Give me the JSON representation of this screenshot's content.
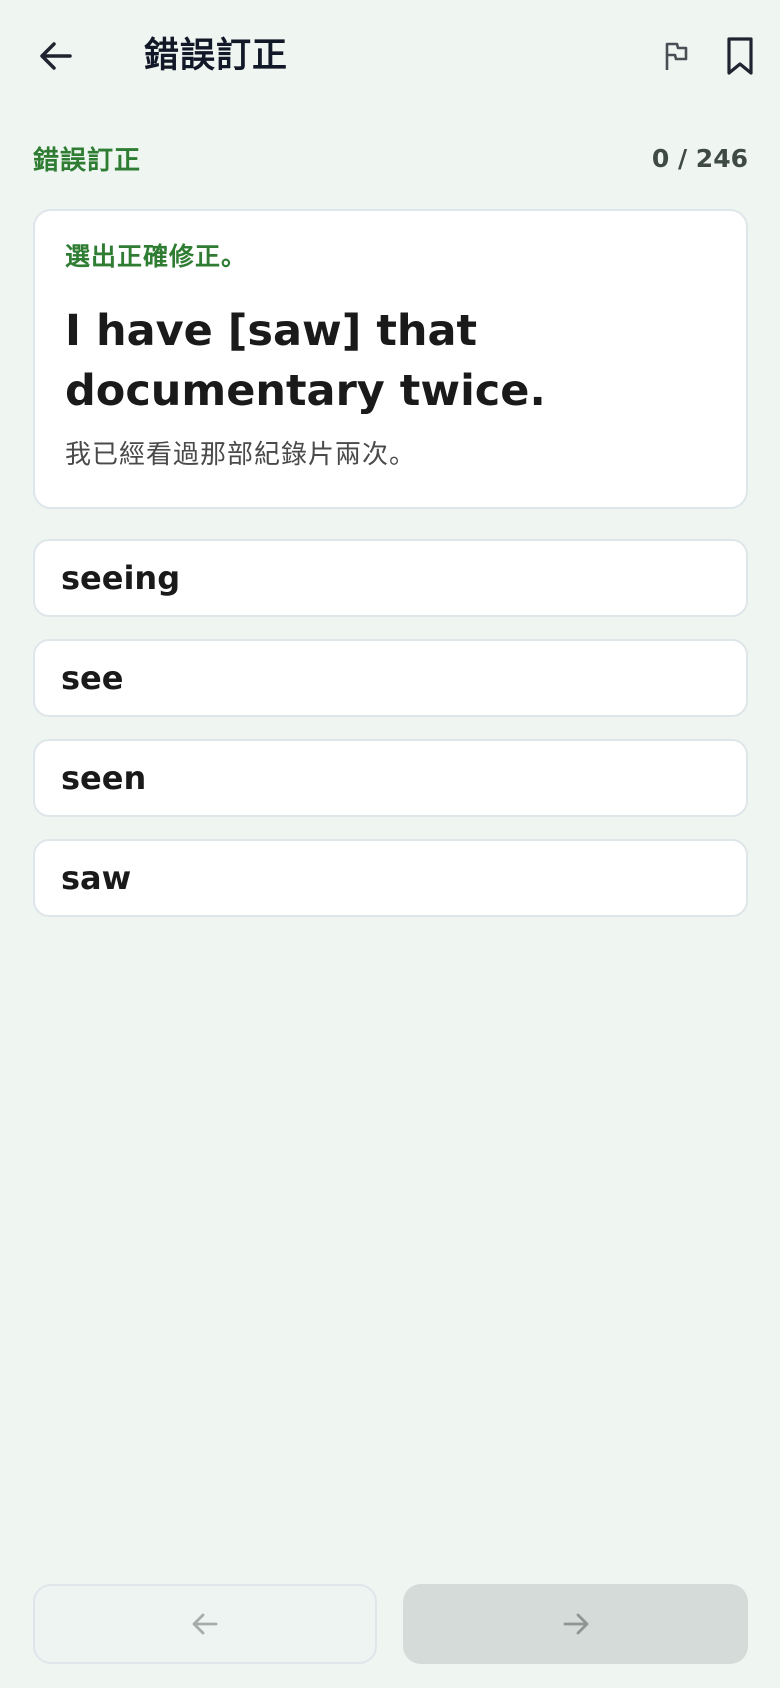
{
  "app_bar": {
    "title": "錯誤訂正",
    "icons": {
      "back": "arrow-left-icon",
      "flag": "flag-icon",
      "bookmark": "bookmark-icon"
    }
  },
  "section": {
    "label": "錯誤訂正",
    "progress": "0 / 246"
  },
  "question": {
    "instruction": "選出正確修正。",
    "sentence": "I have [saw] that documentary twice.",
    "translation": "我已經看過那部紀錄片兩次。"
  },
  "options": [
    {
      "label": "seeing"
    },
    {
      "label": "see"
    },
    {
      "label": "seen"
    },
    {
      "label": "saw"
    }
  ],
  "navigation": {
    "prev_icon": "arrow-left-icon",
    "next_icon": "arrow-right-icon"
  },
  "colors": {
    "accent_green": "#2e7d32",
    "background": "#eff5f1",
    "card": "#ffffff",
    "border": "#dfe6ea",
    "next_disabled": "#d5dbd8"
  }
}
